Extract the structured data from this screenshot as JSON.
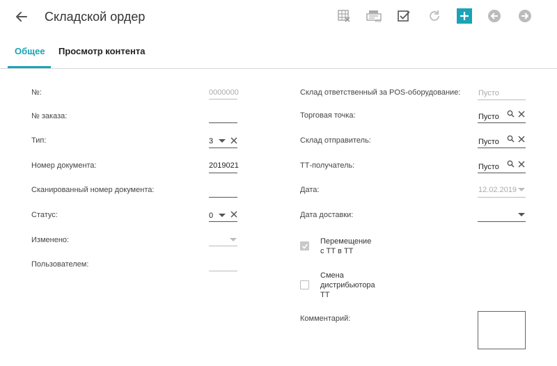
{
  "header": {
    "title": "Складской ордер",
    "icons": [
      "back-arrow-icon",
      "table-delete-icon",
      "pos-printer-icon",
      "checkbox-icon",
      "refresh-icon",
      "add-icon",
      "previous-icon",
      "next-icon"
    ],
    "accent": "#1aa3b8"
  },
  "tabs": [
    {
      "label": "Общее",
      "active": true
    },
    {
      "label": "Просмотр контента",
      "active": false
    }
  ],
  "left": {
    "number": {
      "label": "№:",
      "value": "0000000"
    },
    "order": {
      "label": "№ заказа:",
      "value": ""
    },
    "type": {
      "label": "Тип:",
      "value": "3"
    },
    "doc_number": {
      "label": "Номер документа:",
      "value": "2019021"
    },
    "scanned": {
      "label": "Сканированный номер документа:",
      "value": ""
    },
    "status": {
      "label": "Статус:",
      "value": "0"
    },
    "changed": {
      "label": "Изменено:",
      "value": ""
    },
    "user": {
      "label": "Пользователем:",
      "value": ""
    }
  },
  "right": {
    "pos_warehouse": {
      "label": "Склад ответственный за POS-оборудование:",
      "value": "Пусто"
    },
    "outlet": {
      "label": "Торговая точка:",
      "value": "Пусто"
    },
    "sender": {
      "label": "Склад отправитель:",
      "value": "Пусто"
    },
    "recipient": {
      "label": "ТТ-получатель:",
      "value": "Пусто"
    },
    "date": {
      "label": "Дата:",
      "value": "12.02.2019"
    },
    "delivery_date": {
      "label": "Дата доставки:",
      "value": ""
    },
    "move_between": {
      "label_lines": [
        "Перемещение",
        "с ТТ в ТТ"
      ],
      "checked": true
    },
    "change_distributor": {
      "label_lines": [
        "Смена",
        "дистрибьютора",
        "ТТ"
      ],
      "checked": false
    },
    "comment": {
      "label": "Комментарий:",
      "value": ""
    }
  }
}
